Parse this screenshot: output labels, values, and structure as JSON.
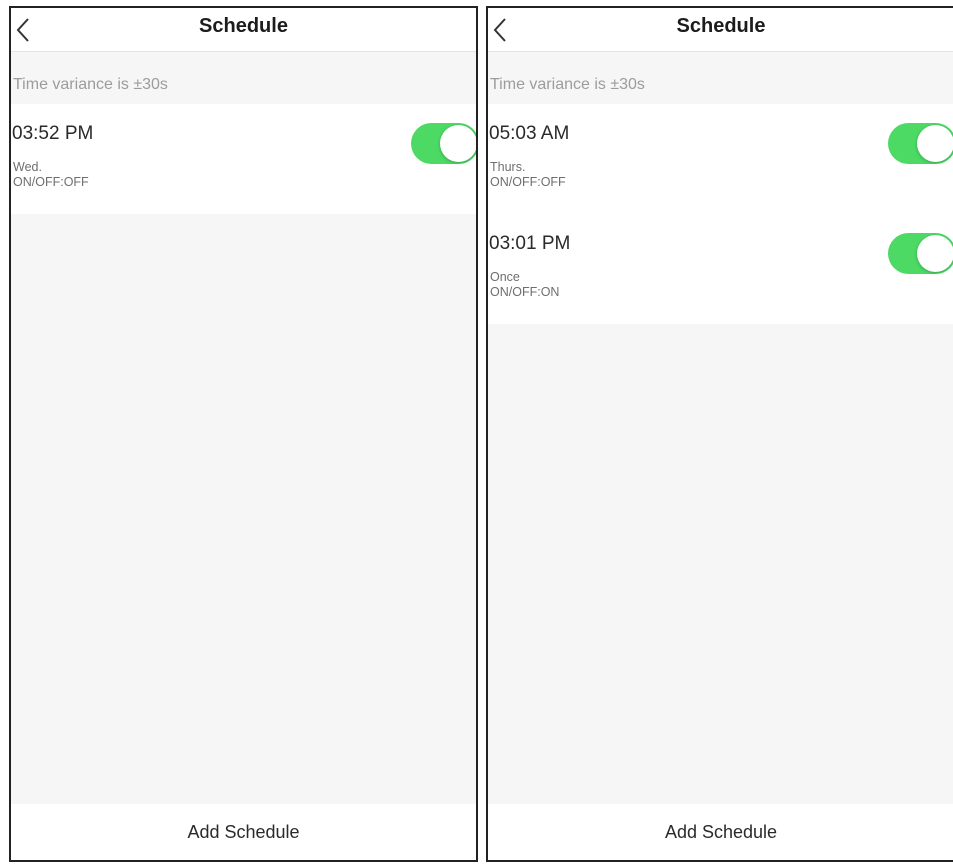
{
  "screens": [
    {
      "title": "Schedule",
      "variance_text": "Time variance is  ±30s",
      "schedules": [
        {
          "time": "03:52 PM",
          "days": "Wed.",
          "action": "ON/OFF:OFF",
          "enabled": true
        }
      ],
      "add_label": "Add Schedule"
    },
    {
      "title": "Schedule",
      "variance_text": "Time variance is  ±30s",
      "schedules": [
        {
          "time": "05:03 AM",
          "days": "Thurs.",
          "action": "ON/OFF:OFF",
          "enabled": true
        },
        {
          "time": "03:01 PM",
          "days": "Once",
          "action": "ON/OFF:ON",
          "enabled": true
        }
      ],
      "add_label": "Add Schedule"
    }
  ],
  "colors": {
    "toggle_on": "#4cd964",
    "background": "#f6f6f6",
    "variance_text": "#9c9c9c"
  },
  "icons": {
    "back": "chevron-left-icon"
  }
}
